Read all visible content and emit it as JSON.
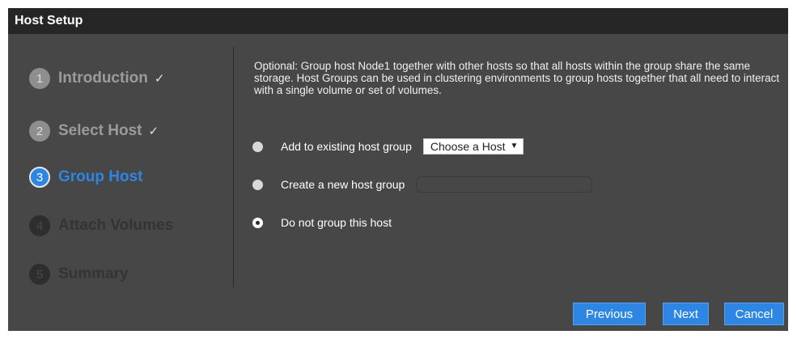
{
  "window": {
    "title": "Host Setup"
  },
  "wizard": {
    "steps": [
      {
        "number": "1",
        "label": "Introduction",
        "state": "done",
        "check": "✓"
      },
      {
        "number": "2",
        "label": "Select Host",
        "state": "done",
        "check": "✓"
      },
      {
        "number": "3",
        "label": "Group Host",
        "state": "current",
        "check": ""
      },
      {
        "number": "4",
        "label": "Attach Volumes",
        "state": "todo",
        "check": ""
      },
      {
        "number": "5",
        "label": "Summary",
        "state": "todo",
        "check": ""
      }
    ]
  },
  "content": {
    "description": "Optional: Group host Node1 together with other hosts so that all hosts within the group share the same storage. Host Groups can be used in clustering environments to group hosts together that all need to interact with a single volume or set of volumes.",
    "options": {
      "existing": {
        "label": "Add to existing host group",
        "selected": false
      },
      "new": {
        "label": "Create a new host group",
        "selected": false,
        "value": ""
      },
      "none": {
        "label": "Do not group this host",
        "selected": true
      }
    },
    "host_select": {
      "value": "Choose a Host",
      "caret": "▼"
    }
  },
  "buttons": {
    "previous": "Previous",
    "next": "Next",
    "cancel": "Cancel"
  },
  "colors": {
    "accent": "#2d86e3",
    "panel": "#474747",
    "titlebar": "#262626"
  }
}
